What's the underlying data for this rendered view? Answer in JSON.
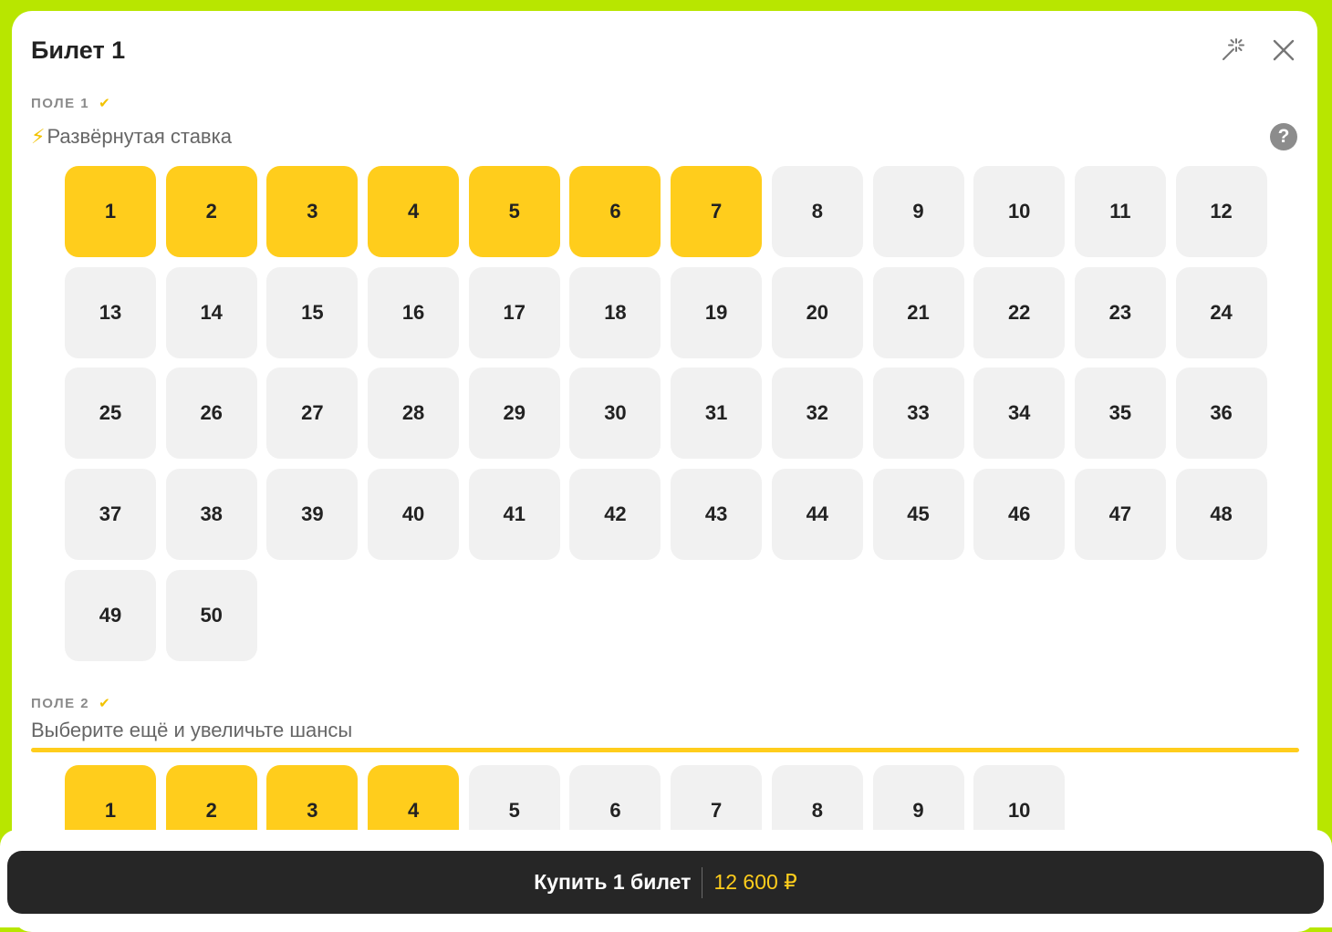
{
  "ticket": {
    "title": "Билет 1",
    "magic_icon": "magic-wand-icon",
    "close_icon": "close-icon"
  },
  "field1": {
    "label": "ПОЛЕ 1",
    "check": "✔",
    "mode_icon": "⚡",
    "mode_label": "Развёрнутая ставка",
    "help": "?",
    "numbers": [
      1,
      2,
      3,
      4,
      5,
      6,
      7,
      8,
      9,
      10,
      11,
      12,
      13,
      14,
      15,
      16,
      17,
      18,
      19,
      20,
      21,
      22,
      23,
      24,
      25,
      26,
      27,
      28,
      29,
      30,
      31,
      32,
      33,
      34,
      35,
      36,
      37,
      38,
      39,
      40,
      41,
      42,
      43,
      44,
      45,
      46,
      47,
      48,
      49,
      50
    ],
    "selected": [
      1,
      2,
      3,
      4,
      5,
      6,
      7
    ]
  },
  "field2": {
    "label": "ПОЛЕ 2",
    "check": "✔",
    "hint": "Выберите ещё и увеличьте шансы",
    "progress": 1.0,
    "numbers": [
      1,
      2,
      3,
      4,
      5,
      6,
      7,
      8,
      9,
      10
    ],
    "selected": [
      1,
      2,
      3,
      4
    ]
  },
  "buy": {
    "label": "Купить 1 билет",
    "price": "12 600 ₽"
  },
  "colors": {
    "accent": "#ffcd1c",
    "background": "#b8e600",
    "cell": "#f1f1f1",
    "button": "#262626"
  }
}
